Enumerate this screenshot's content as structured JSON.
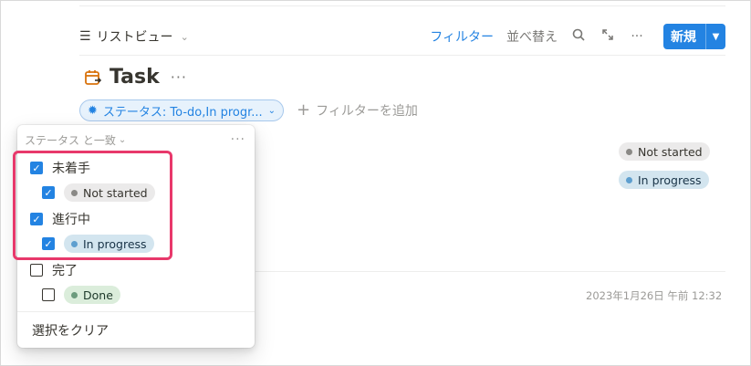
{
  "toolbar": {
    "view_label": "リストビュー",
    "filter_label": "フィルター",
    "sort_label": "並べ替え",
    "new_label": "新規"
  },
  "icons": {
    "list": "list-icon",
    "search": "search-icon",
    "expand": "expand-icon",
    "more": "more-icon",
    "calendar": "calendar-icon",
    "spinner": "status-icon"
  },
  "title": "Task",
  "filter_chip": "ステータス: To-do,In progr...",
  "add_filter": "フィルターを追加",
  "right_tags": [
    {
      "label": "Not started",
      "color": "gray"
    },
    {
      "label": "In progress",
      "color": "blue"
    }
  ],
  "timestamp": "2023年1月26日 午前 12:32",
  "popup": {
    "header": "ステータス と一致",
    "groups": [
      {
        "label": "未着手",
        "checked": true
      },
      {
        "label": "Not started",
        "checked": true
      },
      {
        "label": "進行中",
        "checked": true
      },
      {
        "label": "In progress",
        "checked": true
      },
      {
        "label": "完了",
        "checked": false
      },
      {
        "label": "Done",
        "checked": false
      }
    ],
    "clear_label": "選択をクリア"
  },
  "colors": {
    "accent": "#2383e2",
    "highlight": "#e8386b"
  }
}
